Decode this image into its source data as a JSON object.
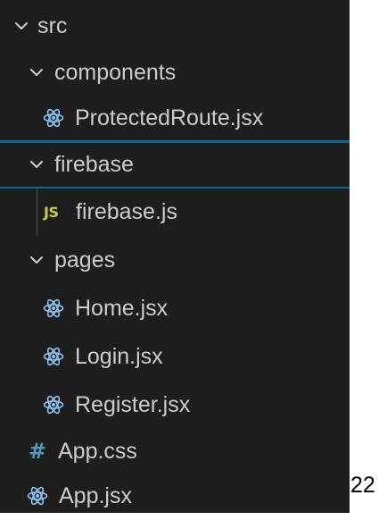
{
  "tree": {
    "root_folder": "src",
    "components_folder": "components",
    "protected_route_file": "ProtectedRoute.jsx",
    "firebase_folder": "firebase",
    "firebase_js_file": "firebase.js",
    "pages_folder": "pages",
    "home_file": "Home.jsx",
    "login_file": "Login.jsx",
    "register_file": "Register.jsx",
    "app_css_file": "App.css",
    "app_jsx_file": "App.jsx"
  },
  "icons": {
    "js_label": "JS",
    "css_label": "#",
    "react_color": "#8dc4f0",
    "js_color": "#cbcb41",
    "css_color": "#519aba"
  },
  "trailing_text": "22"
}
